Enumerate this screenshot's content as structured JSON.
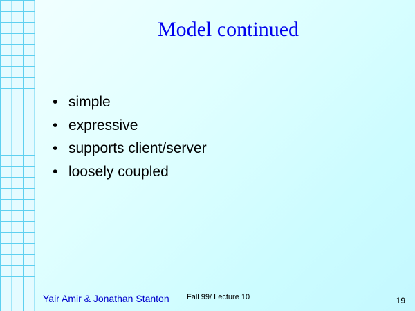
{
  "slide": {
    "title": "Model continued",
    "bullet_symbol": "•",
    "bullets": [
      "simple",
      "expressive",
      "supports client/server",
      "loosely coupled"
    ],
    "footer": {
      "author": "Yair Amir & Jonathan Stanton",
      "course": "Fall 99/ Lecture 10",
      "page_number": "19"
    },
    "colors": {
      "title": "#0000ee",
      "author": "#0000cc",
      "background": "#e0ffff",
      "grid_lines": "#5ed0f0"
    }
  }
}
